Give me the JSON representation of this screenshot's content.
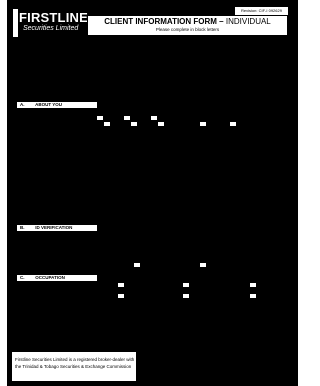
{
  "logo": {
    "wordmark": "FIRSTLINE",
    "tagline": "Securities Limited"
  },
  "header": {
    "revision": "Revision: CIF-I 092629",
    "title_bold": "CLIENT INFORMATION FORM –",
    "title_rest": "INDIVIDUAL",
    "subtitle": "Please complete in block letters"
  },
  "sections": [
    {
      "letter": "A.",
      "label": "ABOUT YOU"
    },
    {
      "letter": "B.",
      "label": "ID VERIFICATION"
    },
    {
      "letter": "C.",
      "label": "OCCUPATION"
    }
  ],
  "footer": {
    "line1": "Firstline Securities Limited is a registered broker-dealer with",
    "line2": "the Trinidad & Tobago Securities & Exchange Commission"
  },
  "colors": {
    "page_background": "#000000",
    "paper": "#ffffff"
  }
}
